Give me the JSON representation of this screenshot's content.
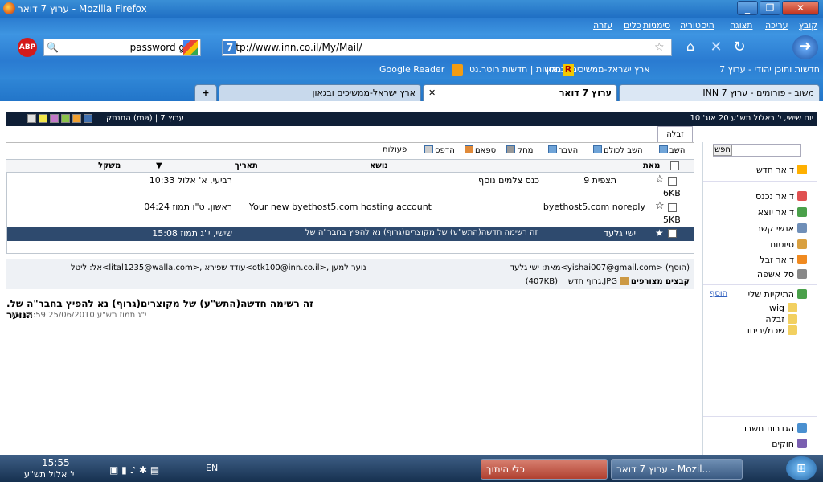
{
  "window": {
    "title": "ערוץ 7 דואר - Mozilla Firefox",
    "min": "_",
    "max": "❐",
    "close": "✕"
  },
  "menu": [
    "קובץ",
    "עריכה",
    "תצוגה",
    "היסטוריה",
    "סימניות",
    "כלים",
    "עזרה"
  ],
  "nav": {
    "url": "http://www.inn.co.il/My/Mail/",
    "search_value": "password gen",
    "abp": "ABP"
  },
  "bookmarks": [
    "חדשות ותוכן יהודי - ערוץ 7",
    "ארץ ישראל-ממשיכים ובגאון",
    "חדשות | חדשות רוטר.נט",
    "Google Reader"
  ],
  "tabs": [
    "INN משוב - פורומים - ערוץ 7",
    "ערוץ 7 דואר",
    "ארץ ישראל-ממשיכים ובגאון",
    "+"
  ],
  "topstrip": {
    "date": "יום שישי, י' באלול תש\"ע 20 אוג' 10",
    "user": "התנתק (ma) | ערוץ 7"
  },
  "folder_tab": "זבלה",
  "toolbar": [
    "השב",
    "השב לכולם",
    "העבר",
    "מחק",
    "ספאם",
    "הדפס",
    "פעולות"
  ],
  "search_btn": "חפש",
  "sidebar": {
    "compose": "דואר חדש",
    "folders": [
      "דואר נכנס",
      "דואר יוצא",
      "אנשי קשר",
      "טיוטות",
      "דואר זבל",
      "סל אשפה"
    ],
    "my_folders": "התיקיות שלי",
    "add": "הוסף",
    "custom": [
      "wig",
      "זבלה",
      "שכמ/יריחו"
    ],
    "settings": "הגדרות חשבון",
    "rules": "חוקים"
  },
  "grid": {
    "headers": [
      "מאת",
      "נושא",
      "תאריך",
      "משקל"
    ],
    "rows": [
      {
        "from": "תצפית 9",
        "subject": "כנס צלמים נוסף",
        "date": "רביעי, א' אלול 10:33",
        "size": "6KB"
      },
      {
        "from": "byethost5.com noreply",
        "subject": "Your new byethost5.com hosting account",
        "date": "ראשון, ט\"ו תמוז 04:24",
        "size": "5KB"
      },
      {
        "from": "ישי גלעד",
        "subject": "זה רשימה חדשה(התש\"ע) של מקוצרים(גרוף) נא להפיץ בחבר\"ה של",
        "date": "שישי, י\"ג תמוז 15:08",
        "size": ""
      }
    ]
  },
  "message": {
    "from": "מאת: ישי גלעד<yishai007@gmail.com> (הוסף)",
    "to": "אל: ליטל<lital1235@walla.com>, עודד שפירא<otk100@inn.co.il>, נוער למען",
    "attachments_label": "קבצים מצורפים",
    "attachment": "גרוף חדש.JPG",
    "attachment_size": "(407KB)",
    "body": ".זה רשימה חדשה(התש\"ע) של מקוצרים(גרוף) נא להפיץ בחבר\"ה של הנוער",
    "timestamp": "י\"ג תמוז תש\"ע 25/06/2010 15:08:59"
  },
  "taskbar": {
    "tasks": [
      "ערוץ 7 דואר - Mozil...",
      "כלי היתוך"
    ],
    "lang": "EN",
    "time": "15:55",
    "date": "י' אלול תש\"ע"
  }
}
